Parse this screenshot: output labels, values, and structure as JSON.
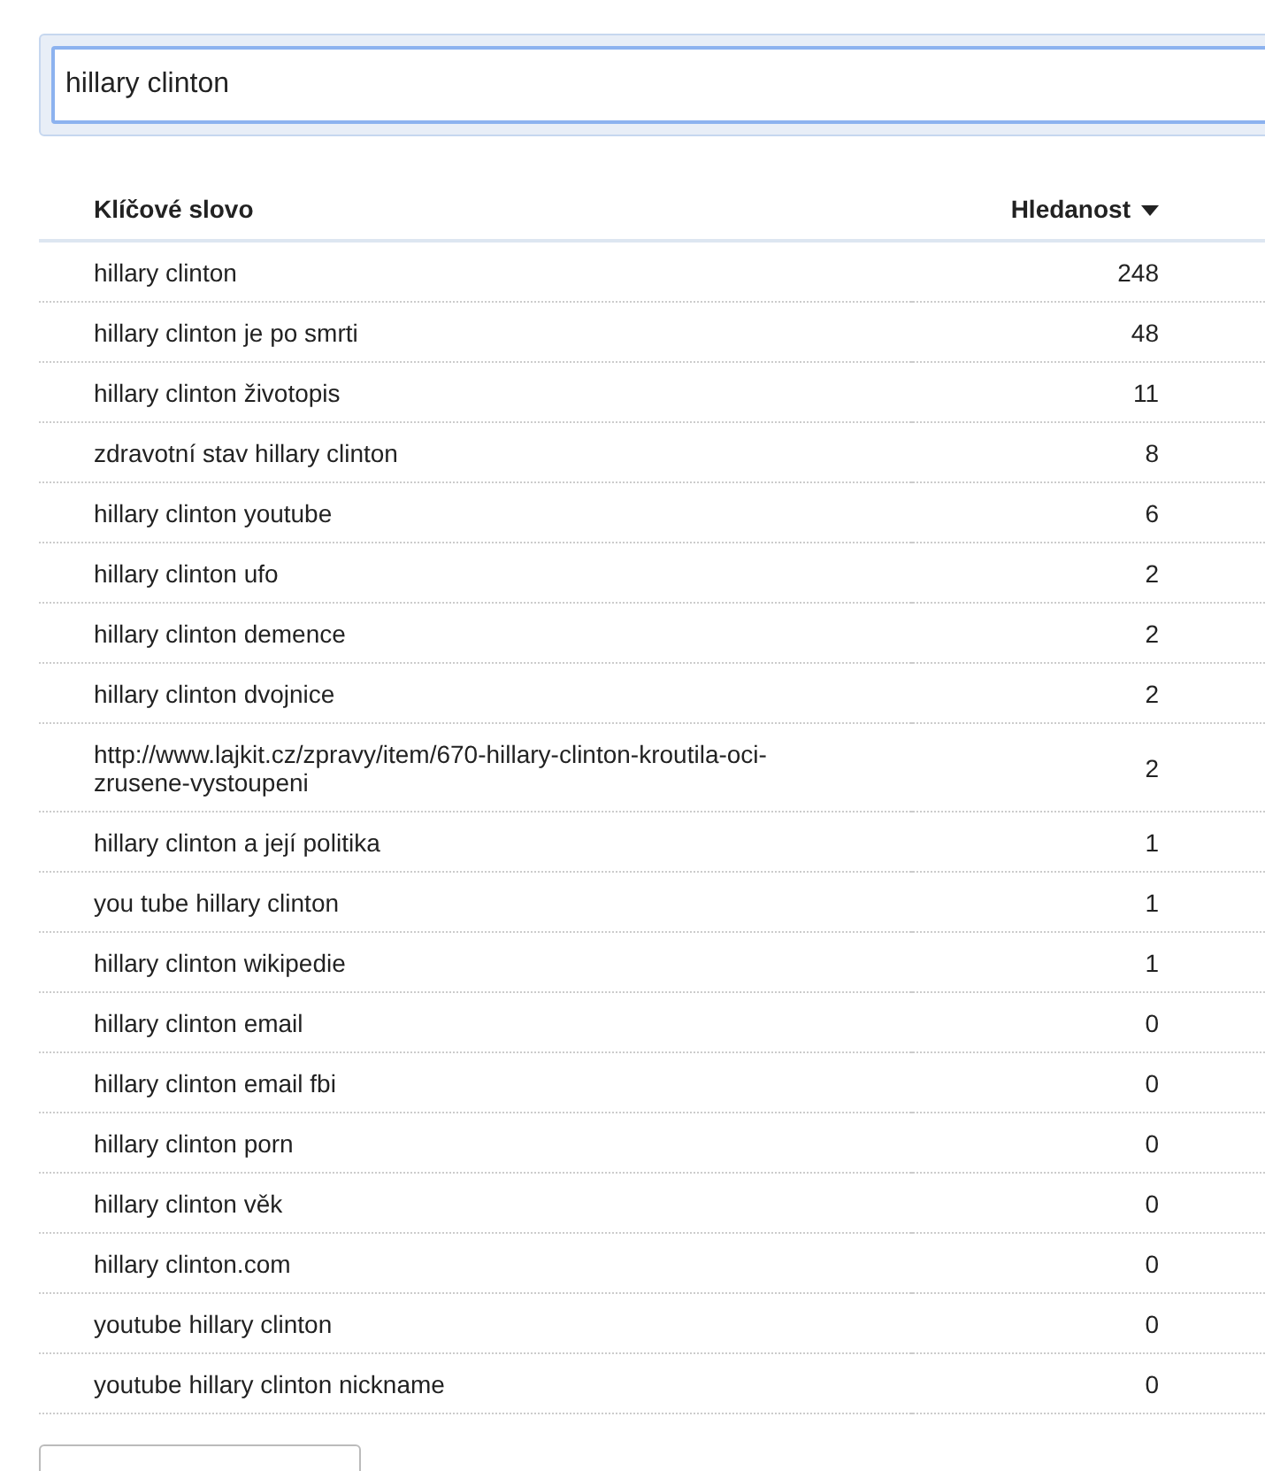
{
  "search": {
    "value": "hillary clinton"
  },
  "table": {
    "columns": [
      {
        "label": "Klíčové slovo",
        "sorted": false
      },
      {
        "label": "Hledanost",
        "sorted": true
      }
    ],
    "rows": [
      {
        "keyword": "hillary clinton",
        "count": "248"
      },
      {
        "keyword": "hillary clinton je po smrti",
        "count": "48"
      },
      {
        "keyword": "hillary clinton životopis",
        "count": "11"
      },
      {
        "keyword": "zdravotní stav hillary clinton",
        "count": "8"
      },
      {
        "keyword": "hillary clinton youtube",
        "count": "6"
      },
      {
        "keyword": "hillary clinton ufo",
        "count": "2"
      },
      {
        "keyword": "hillary clinton demence",
        "count": "2"
      },
      {
        "keyword": "hillary clinton dvojnice",
        "count": "2"
      },
      {
        "keyword": "http://www.lajkit.cz/zpravy/item/670-hillary-clinton-kroutila-oci-zrusene-vystoupeni",
        "count": "2"
      },
      {
        "keyword": "hillary clinton a její politika",
        "count": "1"
      },
      {
        "keyword": "you tube hillary clinton",
        "count": "1"
      },
      {
        "keyword": "hillary clinton wikipedie",
        "count": "1"
      },
      {
        "keyword": "hillary clinton email",
        "count": "0"
      },
      {
        "keyword": "hillary clinton email fbi",
        "count": "0"
      },
      {
        "keyword": "hillary clinton porn",
        "count": "0"
      },
      {
        "keyword": "hillary clinton věk",
        "count": "0"
      },
      {
        "keyword": "hillary clinton.com",
        "count": "0"
      },
      {
        "keyword": "youtube hillary clinton",
        "count": "0"
      },
      {
        "keyword": "youtube hillary clinton nickname",
        "count": "0"
      }
    ]
  }
}
